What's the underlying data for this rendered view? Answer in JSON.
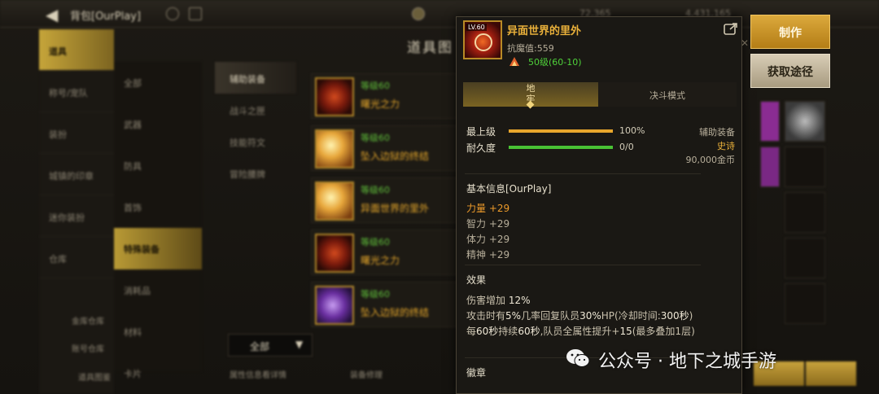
{
  "header": {
    "title": "背包[OurPlay]",
    "gold": "72,365",
    "coins": "4,431,165"
  },
  "left_menu": {
    "items": [
      "道具",
      "称号/宠队",
      "装扮",
      "城镇的印章",
      "迷你装扮",
      "仓库"
    ],
    "bottom": [
      "金库仓库",
      "账号仓库",
      "道具图鉴"
    ]
  },
  "middle": {
    "title": "道具图",
    "categories": [
      "全部",
      "武器",
      "防具",
      "首饰",
      "特殊装备",
      "消耗品",
      "材料",
      "卡片"
    ],
    "sub_categories": [
      "辅助装备",
      "战斗之匣",
      "技能符文",
      "冒险腰牌"
    ],
    "items": [
      {
        "level": "等级60",
        "name": "曙光之力",
        "icon": "red-orb-icon"
      },
      {
        "level": "等级60",
        "name": "坠入边狱的终结",
        "icon": "gold-flame-icon"
      },
      {
        "level": "等级60",
        "name": "异面世界的里外",
        "icon": "gold-flame-icon"
      },
      {
        "level": "等级60",
        "name": "曙光之力",
        "icon": "red-orb-icon"
      },
      {
        "level": "等级60",
        "name": "坠入边狱的终结",
        "icon": "purple-rift-icon"
      }
    ],
    "filter": "全部",
    "bottom_left": "属性信息看详情",
    "bottom_mid": "装备修理"
  },
  "tooltip": {
    "icon_level_tag": "LV.60",
    "name": "异面世界的里外",
    "resist": "抗魔值:559",
    "level": "50级(60-10)",
    "tabs": {
      "active": "地牢",
      "inactive": "决斗模式"
    },
    "bars": [
      {
        "label": "最上级",
        "value": "100%",
        "percent": 100,
        "color": "#e8a62c"
      },
      {
        "label": "耐久度",
        "value": "0/0",
        "percent": 100,
        "color": "#49c234"
      }
    ],
    "type": "辅助装备",
    "rarity": "史诗",
    "price": "90,000金币",
    "basic_title": "基本信息[OurPlay]",
    "stats": [
      {
        "text": "力量 +29",
        "highlight": true
      },
      {
        "text": "智力 +29",
        "highlight": false
      },
      {
        "text": "体力 +29",
        "highlight": false
      },
      {
        "text": "精神 +29",
        "highlight": false
      }
    ],
    "effect_title": "效果",
    "effects": [
      {
        "pre": "伤害增加 ",
        "hl": "12%",
        "post": ""
      },
      {
        "pre": "攻击时有",
        "hl": "5%",
        "post": "几率回复队员",
        "hl2": "30%",
        "post2": "HP(冷却时间:",
        "hl3": "300秒",
        "post3": ")"
      },
      {
        "pre": "每",
        "hl": "60秒",
        "post": "持续",
        "hl2": "60秒",
        "post2": ",队员全属性提升+",
        "hl3": "15",
        "post3": "(最多叠加1层)"
      }
    ],
    "emblem_title": "徽章"
  },
  "actions": {
    "make": "制作",
    "get_route": "获取途径"
  },
  "watermark": "公众号 · 地下之城手游"
}
